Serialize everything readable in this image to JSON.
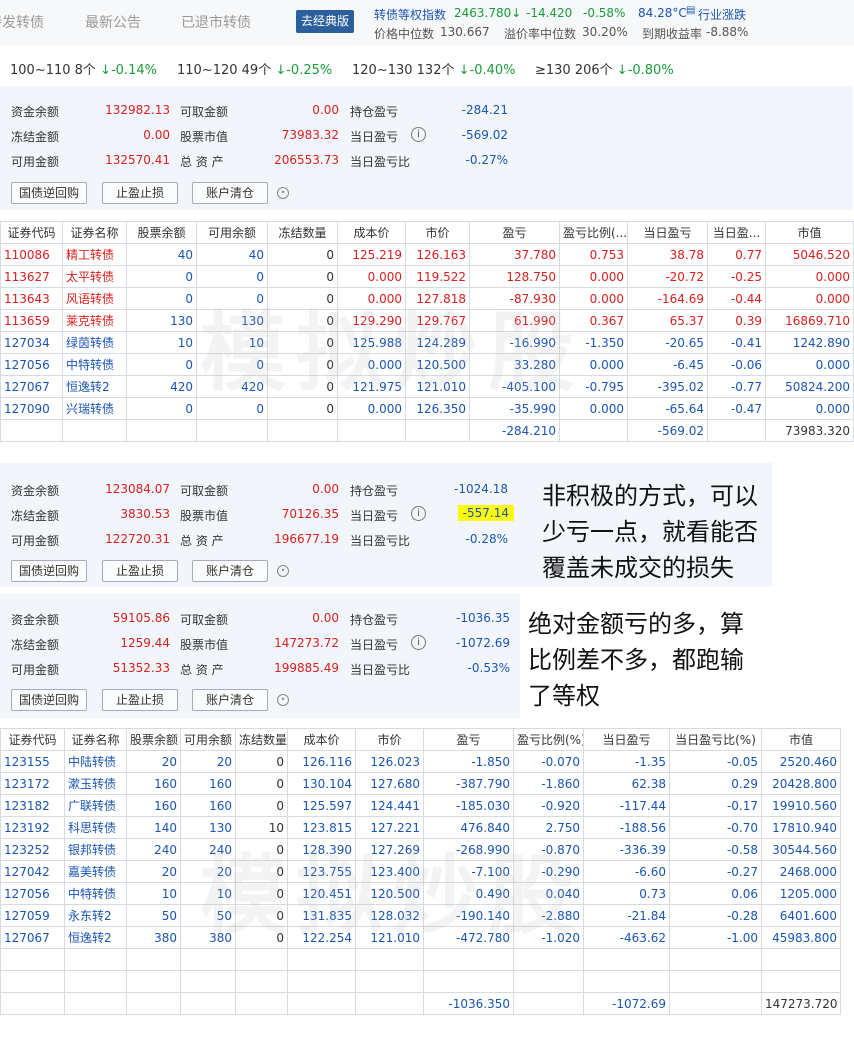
{
  "header": {
    "tabs": [
      "待发转债",
      "最新公告",
      "已退市转债"
    ],
    "classic_btn": "去经典版",
    "index_label": "转债等权指数",
    "index_value": "2463.780↓",
    "index_change": "-14.420",
    "index_pct": "-0.58%",
    "temp": "84.28°C",
    "industry": "行业涨跌",
    "price_median_label": "价格中位数",
    "price_median": "130.667",
    "premium_label": "溢价率中位数",
    "premium": "30.20%",
    "ytm_label": "到期收益率",
    "ytm": "-8.88%"
  },
  "ranges": [
    {
      "label": "100~110 8个",
      "val": "↓-0.14%"
    },
    {
      "label": "110~120 49个",
      "val": "↓-0.25%"
    },
    {
      "label": "120~130 132个",
      "val": "↓-0.40%"
    },
    {
      "label": "≥130 206个",
      "val": "↓-0.80%"
    }
  ],
  "labels": {
    "cash": "资金余额",
    "frozen": "冻结金额",
    "available": "可用金额",
    "withdrawable": "可取金额",
    "stock_value": "股票市值",
    "total": "总 资 产",
    "hold_pl": "持仓盈亏",
    "day_pl": "当日盈亏",
    "day_pl_pct": "当日盈亏比",
    "btn_repo": "国债逆回购",
    "btn_stop": "止盈止损",
    "btn_clear": "账户清仓"
  },
  "account1": {
    "cash": "132982.13",
    "frozen": "0.00",
    "available": "132570.41",
    "withdrawable": "0.00",
    "stock_value": "73983.32",
    "total": "206553.73",
    "hold_pl": "-284.21",
    "day_pl": "-569.02",
    "day_pl_pct": "-0.27%"
  },
  "table1_headers": [
    "证券代码",
    "证券名称",
    "股票余额",
    "可用余额",
    "冻结数量",
    "成本价",
    "市价",
    "盈亏",
    "盈亏比例(...",
    "当日盈亏",
    "当日盈...",
    "市值"
  ],
  "table1_rows": [
    [
      "110086",
      "精工转债",
      "40",
      "40",
      "0",
      "125.219",
      "126.163",
      "37.780",
      "0.753",
      "38.78",
      "0.77",
      "5046.520"
    ],
    [
      "113627",
      "太平转债",
      "0",
      "0",
      "0",
      "0.000",
      "119.522",
      "128.750",
      "0.000",
      "-20.72",
      "-0.25",
      "0.000"
    ],
    [
      "113643",
      "风语转债",
      "0",
      "0",
      "0",
      "0.000",
      "127.818",
      "-87.930",
      "0.000",
      "-164.69",
      "-0.44",
      "0.000"
    ],
    [
      "113659",
      "莱克转债",
      "130",
      "130",
      "0",
      "129.290",
      "129.767",
      "61.990",
      "0.367",
      "65.37",
      "0.39",
      "16869.710"
    ],
    [
      "127034",
      "绿茵转债",
      "10",
      "10",
      "0",
      "125.988",
      "124.289",
      "-16.990",
      "-1.350",
      "-20.65",
      "-0.41",
      "1242.890"
    ],
    [
      "127056",
      "中特转债",
      "0",
      "0",
      "0",
      "0.000",
      "120.500",
      "33.280",
      "0.000",
      "-6.45",
      "-0.06",
      "0.000"
    ],
    [
      "127067",
      "恒逸转2",
      "420",
      "420",
      "0",
      "121.975",
      "121.010",
      "-405.100",
      "-0.795",
      "-395.02",
      "-0.77",
      "50824.200"
    ],
    [
      "127090",
      "兴瑞转债",
      "0",
      "0",
      "0",
      "0.000",
      "126.350",
      "-35.990",
      "0.000",
      "-65.64",
      "-0.47",
      "0.000"
    ]
  ],
  "table1_total": {
    "pl": "-284.210",
    "day_pl": "-569.02",
    "value": "73983.320"
  },
  "account2": {
    "cash": "123084.07",
    "frozen": "3830.53",
    "available": "122720.31",
    "withdrawable": "0.00",
    "stock_value": "70126.35",
    "total": "196677.19",
    "hold_pl": "-1024.18",
    "day_pl": "-557.14",
    "day_pl_pct": "-0.28%"
  },
  "note1": [
    "非积极的方式，可以",
    "少亏一点，就看能否",
    "覆盖未成交的损失"
  ],
  "account3": {
    "cash": "59105.86",
    "frozen": "1259.44",
    "available": "51352.33",
    "withdrawable": "0.00",
    "stock_value": "147273.72",
    "total": "199885.49",
    "hold_pl": "-1036.35",
    "day_pl": "-1072.69",
    "day_pl_pct": "-0.53%"
  },
  "note2": [
    "绝对金额亏的多，算",
    "比例差不多，都跑输",
    "了等权"
  ],
  "table2_headers": [
    "证券代码",
    "证券名称",
    "股票余额",
    "可用余额",
    "冻结数量",
    "成本价",
    "市价",
    "盈亏",
    "盈亏比例(%)",
    "当日盈亏",
    "当日盈亏比(%)",
    "市值"
  ],
  "table2_rows": [
    [
      "123155",
      "中陆转债",
      "20",
      "20",
      "0",
      "126.116",
      "126.023",
      "-1.850",
      "-0.070",
      "-1.35",
      "-0.05",
      "2520.460"
    ],
    [
      "123172",
      "漱玉转债",
      "160",
      "160",
      "0",
      "130.104",
      "127.680",
      "-387.790",
      "-1.860",
      "62.38",
      "0.29",
      "20428.800"
    ],
    [
      "123182",
      "广联转债",
      "160",
      "160",
      "0",
      "125.597",
      "124.441",
      "-185.030",
      "-0.920",
      "-117.44",
      "-0.17",
      "19910.560"
    ],
    [
      "123192",
      "科思转债",
      "140",
      "130",
      "10",
      "123.815",
      "127.221",
      "476.840",
      "2.750",
      "-188.56",
      "-0.70",
      "17810.940"
    ],
    [
      "123252",
      "银邦转债",
      "240",
      "240",
      "0",
      "128.390",
      "127.269",
      "-268.990",
      "-0.870",
      "-336.39",
      "-0.58",
      "30544.560"
    ],
    [
      "127042",
      "嘉美转债",
      "20",
      "20",
      "0",
      "123.755",
      "123.400",
      "-7.100",
      "-0.290",
      "-6.60",
      "-0.27",
      "2468.000"
    ],
    [
      "127056",
      "中特转债",
      "10",
      "10",
      "0",
      "120.451",
      "120.500",
      "0.490",
      "0.040",
      "0.73",
      "0.06",
      "1205.000"
    ],
    [
      "127059",
      "永东转2",
      "50",
      "50",
      "0",
      "131.835",
      "128.032",
      "-190.140",
      "-2.880",
      "-21.84",
      "-0.28",
      "6401.600"
    ],
    [
      "127067",
      "恒逸转2",
      "380",
      "380",
      "0",
      "122.254",
      "121.010",
      "-472.780",
      "-1.020",
      "-463.62",
      "-1.00",
      "45983.800"
    ]
  ],
  "table2_total": {
    "pl": "-1036.350",
    "day_pl": "-1072.69",
    "value": "147273.720"
  },
  "watermark": "模拟炒股"
}
